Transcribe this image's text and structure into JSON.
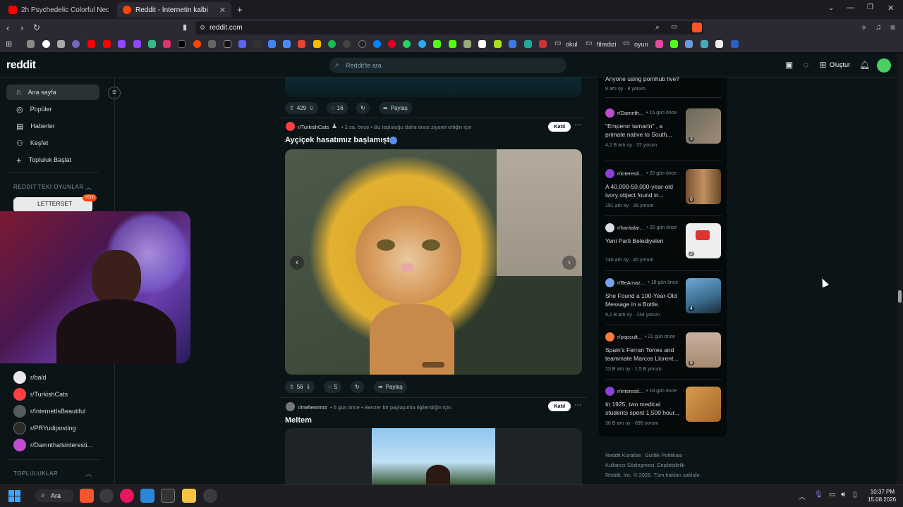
{
  "browser": {
    "tabs": [
      {
        "label": "2h Psychedelic Colorful Neon Backgr",
        "color": "#ff0000",
        "active": false
      },
      {
        "label": "Reddit - İnternetin kalbi",
        "color": "#ff4500",
        "active": true
      }
    ],
    "url": "reddit.com",
    "bookmark_folders": [
      "okul",
      "filmdizi",
      "oyun"
    ]
  },
  "header": {
    "logo": "reddit",
    "search_placeholder": "Reddit'te ara",
    "create_label": "Oluştur"
  },
  "sidebar": {
    "nav": [
      {
        "label": "Ana sayfa",
        "icon": "home-icon",
        "glyph": "⌂"
      },
      {
        "label": "Popüler",
        "icon": "popular-icon",
        "glyph": "◎"
      },
      {
        "label": "Haberler",
        "icon": "news-icon",
        "glyph": "▤"
      },
      {
        "label": "Keşfet",
        "icon": "explore-icon",
        "glyph": "⚇"
      },
      {
        "label": "Topluluk Başlat",
        "icon": "plus-icon",
        "glyph": "+"
      }
    ],
    "games_header": "REDDIT'TEKİ OYUNLAR",
    "game_title": "LETTERSET",
    "game_badge": "YENİ",
    "communities": [
      {
        "name": "r/bald",
        "color": "#e8e8e8"
      },
      {
        "name": "r/TurkishCats",
        "color": "#ff4040"
      },
      {
        "name": "r/InternetIsBeautiful",
        "color": "#555a5e"
      },
      {
        "name": "r/PRYudiposting",
        "color": "#2b2b2b"
      },
      {
        "name": "r/Damnthatsinteresti...",
        "color": "#c04bd0"
      }
    ],
    "communities_header": "TOPLULUKLAR"
  },
  "feed": {
    "prev_actions": {
      "votes": "429",
      "comments": "16",
      "share": "Paylaş"
    },
    "post1": {
      "subreddit": "r/TurkishCats",
      "meta": "• 2 sa. önce • Bu topluluğu daha önce ziyaret ettiğin için",
      "join": "Katıl",
      "title": "Ayçiçek hasatımız başlamıştır",
      "votes": "56",
      "comments": "5",
      "share": "Paylaş"
    },
    "post2": {
      "subreddit": "r/meltemmrz",
      "meta": "• 5 gün önce • Benzer bir paylaşımla ilgilendiğin için",
      "join": "Katıl",
      "title": "Meltem"
    }
  },
  "right": {
    "top_title": "Anyone using pornhub live?",
    "top_stats": "8 artı oy · 8 yorum",
    "items": [
      {
        "sub": "r/Damnth...",
        "time": "• 15 gün önce",
        "title": "\"Emperor tamarin\" , a primate native to South...",
        "stats": "4,2 B artı oy · 37 yorum",
        "badge": "3",
        "thumb": "#8a7a6a"
      },
      {
        "sub": "r/interesti...",
        "time": "• 20 gün önce",
        "title": "A 40.000-50.000-year-old ivory object found in...",
        "stats": "191 artı oy · 39 yorum",
        "badge": "6",
        "thumb": "#a07850"
      },
      {
        "sub": "r/haritalar...",
        "time": "• 20 gün önce",
        "title": "Yeni Parti Belediyeleri",
        "stats": "146 artı oy · 40 yorum",
        "badge": "2",
        "thumb": "#e8e8ea"
      },
      {
        "sub": "r/BeAmaz...",
        "time": "• 18 gün önce",
        "title": "She Found a 100-Year-Old Message in a Bottle.",
        "stats": "9,1 B artı oy · 134 yorum",
        "badge": "4",
        "thumb": "#5a86a8"
      },
      {
        "sub": "r/popcult...",
        "time": "• 22 gün önce",
        "title": "Spain's Ferran Torres and teammate Marcos Llorent...",
        "stats": "13 B artı oy · 1,5 B yorum",
        "badge": "8",
        "thumb": "#b89a8a"
      },
      {
        "sub": "r/interesti...",
        "time": "• 18 gün önce",
        "title": "In 1925, two medical students spent 1,500 hour...",
        "stats": "36 B artı oy · 695 yorum",
        "badge": "",
        "thumb": "#c89050"
      }
    ],
    "footer_links": [
      "Reddit Kuralları",
      "Gizlilik Politikası",
      "Kullanıcı Sözleşmesi",
      "Erişilebilirlik"
    ],
    "copyright": "Reddit, Inc. © 2026. Tüm hakları saklıdır."
  },
  "taskbar": {
    "search": "Ara",
    "time": "10:37 PM",
    "date": "15.08.2026"
  }
}
